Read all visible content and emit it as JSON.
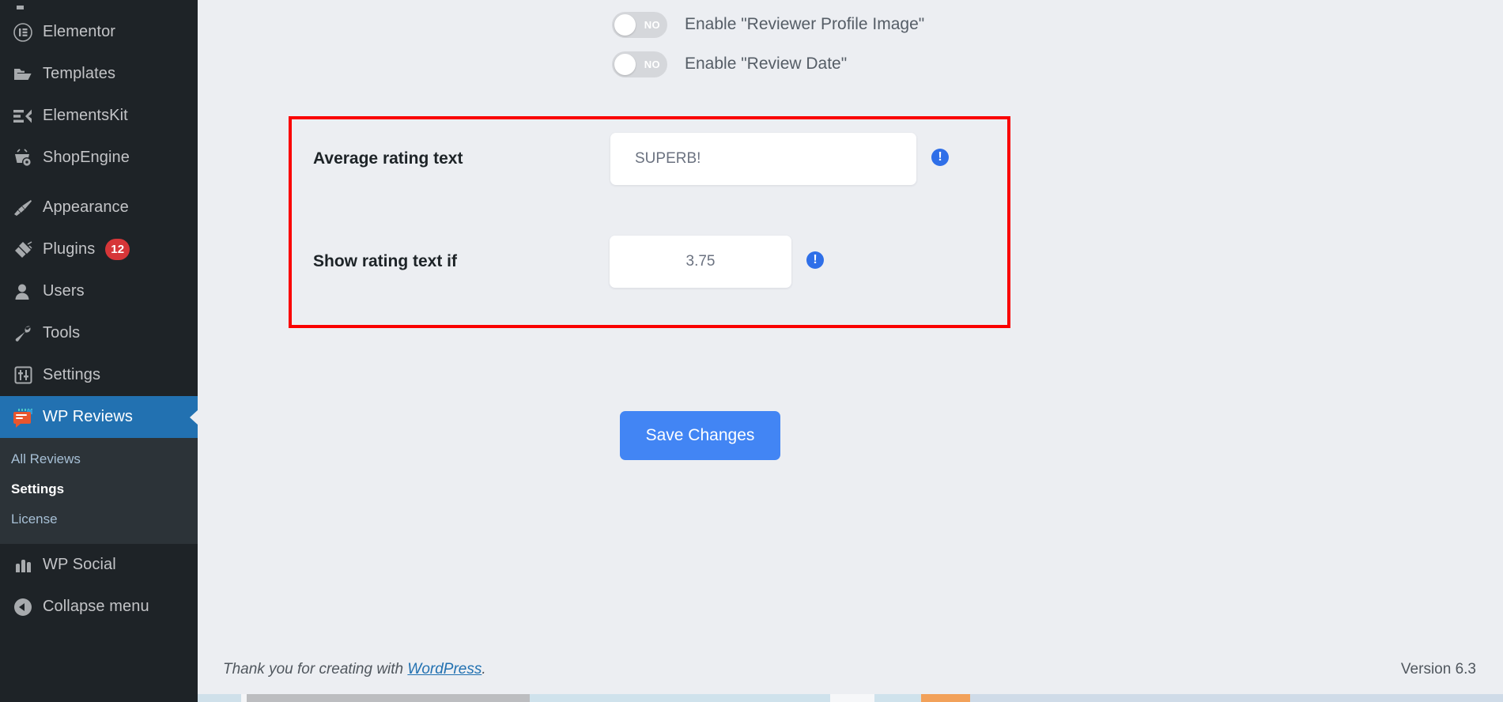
{
  "sidebar": {
    "items": [
      {
        "label": "",
        "icon": "clipped-menu-icon",
        "clipped": true
      },
      {
        "label": "Elementor",
        "icon": "elementor-icon"
      },
      {
        "label": "Templates",
        "icon": "folder-icon"
      },
      {
        "label": "ElementsKit",
        "icon": "elementskit-icon"
      },
      {
        "label": "ShopEngine",
        "icon": "shopengine-basket-icon"
      },
      {
        "label": "Appearance",
        "icon": "paintbrush-icon",
        "gap": true
      },
      {
        "label": "Plugins",
        "icon": "plug-icon",
        "badge": "12"
      },
      {
        "label": "Users",
        "icon": "user-icon"
      },
      {
        "label": "Tools",
        "icon": "wrench-icon"
      },
      {
        "label": "Settings",
        "icon": "sliders-icon"
      }
    ],
    "active_item": {
      "label": "WP Reviews",
      "icon": "wp-reviews-icon"
    },
    "submenu": [
      {
        "label": "All Reviews",
        "current": false
      },
      {
        "label": "Settings",
        "current": true
      },
      {
        "label": "License",
        "current": false
      }
    ],
    "footer_items": [
      {
        "label": "WP Social",
        "icon": "wp-social-icon"
      },
      {
        "label": "Collapse menu",
        "icon": "collapse-menu-icon"
      }
    ],
    "colors": {
      "background": "#1e2327",
      "active": "#2271b1",
      "submenu_background": "#2c3338",
      "badge": "#d63638"
    }
  },
  "main": {
    "toggles": [
      {
        "label": "Enable \"Reviewer Profile Image\"",
        "state": "NO",
        "on": false
      },
      {
        "label": "Enable \"Review Date\"",
        "state": "NO",
        "on": false
      }
    ],
    "highlight": {
      "border_color": "#fa0000"
    },
    "fields": [
      {
        "label": "Average rating text",
        "value": "SUPERB!",
        "info": "!"
      },
      {
        "label": "Show rating text if",
        "value": "3.75",
        "info": "!"
      }
    ],
    "save_button": "Save Changes",
    "save_button_color": "#4285f4"
  },
  "footer": {
    "thanks_prefix": "Thank you for creating with ",
    "thanks_link": "WordPress",
    "thanks_suffix": ".",
    "version": "Version 6.3"
  }
}
